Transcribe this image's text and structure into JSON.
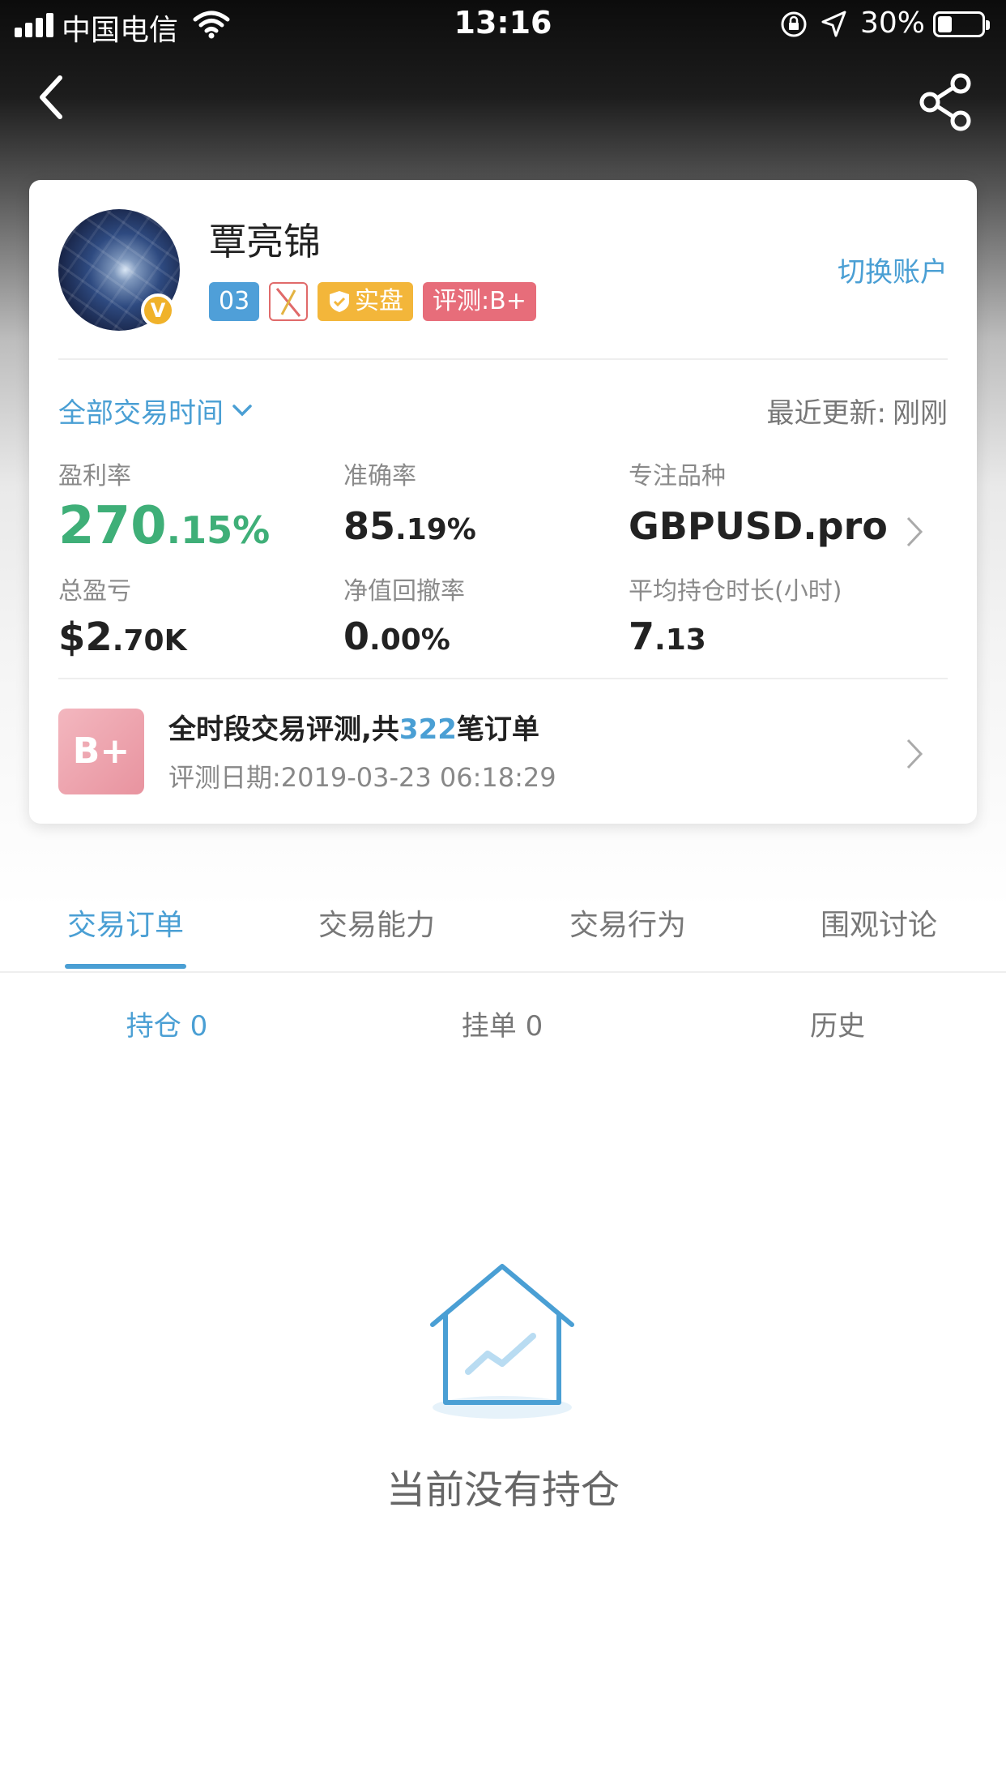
{
  "status_bar": {
    "carrier": "中国电信",
    "time": "13:16",
    "battery": "30%"
  },
  "profile": {
    "name": "覃亮锦",
    "verified_badge": "V",
    "tags": {
      "level": "03",
      "real": "实盘",
      "eval": "评测:B+"
    },
    "switch_account": "切换账户"
  },
  "period": {
    "selector": "全部交易时间",
    "updated_label": "最近更新:",
    "updated_value": "刚刚"
  },
  "stats": {
    "profit_rate": {
      "label": "盈利率",
      "int": "270",
      "dec": ".15%"
    },
    "accuracy": {
      "label": "准确率",
      "int": "85",
      "dec": ".19%"
    },
    "focus": {
      "label": "专注品种",
      "value": "GBPUSD.pro"
    },
    "total_pnl": {
      "label": "总盈亏",
      "int": "$2",
      "dec": ".70K"
    },
    "drawdown": {
      "label": "净值回撤率",
      "int": "0",
      "dec": ".00%"
    },
    "avg_hold": {
      "label": "平均持仓时长(小时)",
      "int": "7",
      "dec": ".13"
    }
  },
  "evaluation": {
    "grade": "B+",
    "title_prefix": "全时段交易评测,共",
    "order_count": "322",
    "title_suffix": "笔订单",
    "date": "评测日期:2019-03-23 06:18:29"
  },
  "tabs": [
    "交易订单",
    "交易能力",
    "交易行为",
    "围观讨论"
  ],
  "subtabs": [
    "持仓 0",
    "挂单 0",
    "历史"
  ],
  "empty_state": {
    "text": "当前没有持仓"
  },
  "colors": {
    "accent": "#4a9fd4",
    "profit_green": "#3faf78",
    "tag_real": "#f3b63a",
    "tag_eval": "#e76d7a"
  },
  "icons": [
    "back-icon",
    "share-icon",
    "chevron-down-icon",
    "chevron-right-icon",
    "empty-house-icon"
  ]
}
